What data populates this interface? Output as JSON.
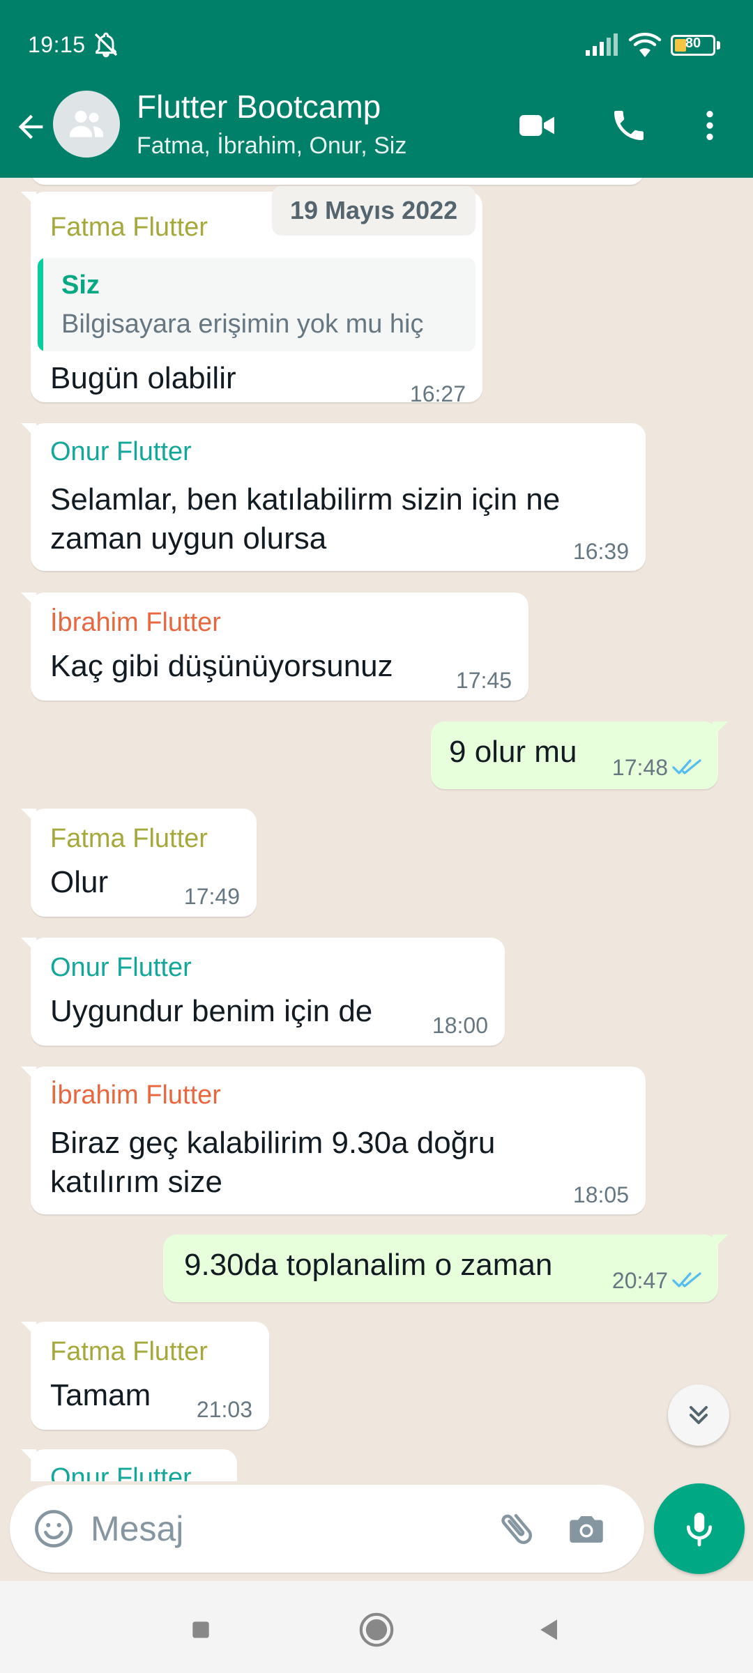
{
  "status_bar": {
    "time": "19:15",
    "battery_level": "80",
    "icons": [
      "bell-off-icon",
      "signal-icon",
      "wifi-icon",
      "battery-icon"
    ]
  },
  "header": {
    "title": "Flutter Bootcamp",
    "subtitle": "Fatma, İbrahim, Onur, Siz",
    "color": "#008069",
    "icons": [
      "back-arrow-icon",
      "group-icon",
      "video-call-icon",
      "phone-icon",
      "more-vert-icon"
    ]
  },
  "date_chip": "19 Mayıs 2022",
  "colors": {
    "fatma": "#a5a83a",
    "onur": "#13a79a",
    "ibrahim": "#e8673f",
    "outgoing_bubble": "#e7ffdb",
    "read_ticks": "#53bdeb",
    "mic_button": "#00a884"
  },
  "messages": [
    {
      "sender": "Fatma Flutter",
      "quote_name": "Siz",
      "quote_text": "Bilgisayara erişimin yok mu hiç",
      "text": "Bugün olabilir",
      "time": "16:27"
    },
    {
      "sender": "Onur Flutter",
      "line1": "Selamlar, ben katılabilirm sizin için ne",
      "line2": "zaman uygun olursa",
      "time": "16:39"
    },
    {
      "sender": "İbrahim Flutter",
      "text": "Kaç gibi düşünüyorsunuz",
      "time": "17:45"
    },
    {
      "text": "9 olur mu",
      "time": "17:48",
      "status": "read"
    },
    {
      "sender": "Fatma Flutter",
      "text": "Olur",
      "time": "17:49"
    },
    {
      "sender": "Onur Flutter",
      "text": "Uygundur benim için de",
      "time": "18:00"
    },
    {
      "sender": "İbrahim Flutter",
      "line1": "Biraz geç kalabilirim 9.30a doğru",
      "line2": "katılırım size",
      "time": "18:05"
    },
    {
      "text": "9.30da toplanalim o zaman",
      "time": "20:47",
      "status": "read"
    },
    {
      "sender": "Fatma Flutter",
      "text": "Tamam",
      "time": "21:03"
    },
    {
      "sender": "Onur Flutter"
    }
  ],
  "composer": {
    "placeholder": "Mesaj",
    "icons": [
      "emoji-icon",
      "attach-icon",
      "camera-icon",
      "mic-icon"
    ]
  },
  "nav_bar": {
    "icons": [
      "recents-icon",
      "home-icon",
      "back-icon"
    ]
  }
}
